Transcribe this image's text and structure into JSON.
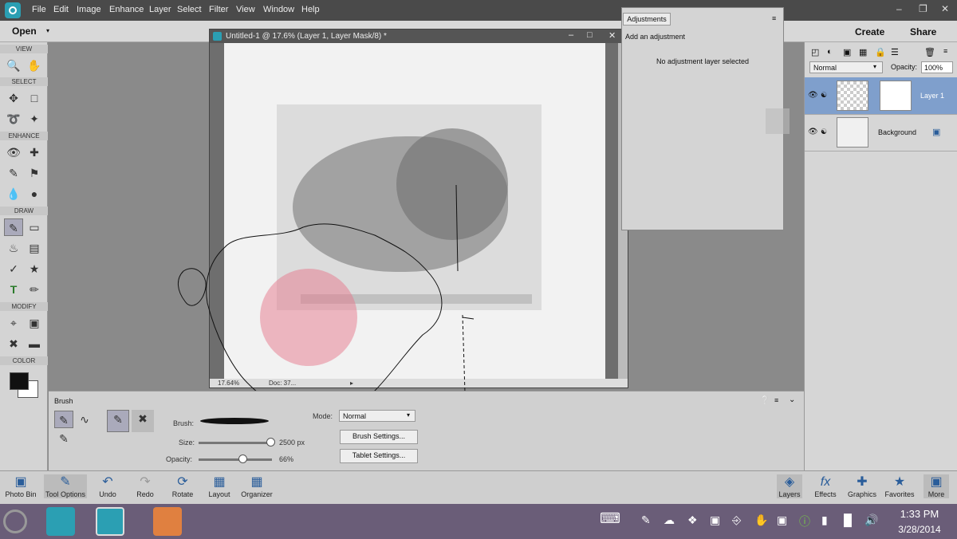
{
  "menu": [
    "File",
    "Edit",
    "Image",
    "Enhance",
    "Layer",
    "Select",
    "Filter",
    "View",
    "Window",
    "Help"
  ],
  "topbar": {
    "open": "Open",
    "create": "Create",
    "share": "Share"
  },
  "toolbox": {
    "sections": {
      "view": "VIEW",
      "select": "SELECT",
      "enhance": "ENHANCE",
      "draw": "DRAW",
      "modify": "MODIFY",
      "color": "COLOR"
    }
  },
  "document": {
    "title": "Untitled-1 @ 17.6% (Layer 1, Layer Mask/8) *",
    "zoom": "17.64%",
    "doc": "Doc: 37..."
  },
  "adjustments": {
    "tab": "Adjustments",
    "title": "Add an adjustment",
    "message": "No adjustment layer selected"
  },
  "layers": {
    "blend_mode": "Normal",
    "opacity_label": "Opacity:",
    "opacity_value": "100%",
    "items": [
      {
        "name": "Layer 1"
      },
      {
        "name": "Background"
      }
    ]
  },
  "tool_options": {
    "name": "Brush",
    "brush_label": "Brush:",
    "size_label": "Size:",
    "size_value": "2500 px",
    "opacity_label": "Opacity:",
    "opacity_value": "66%",
    "mode_label": "Mode:",
    "mode_value": "Normal",
    "brush_settings": "Brush Settings...",
    "tablet_settings": "Tablet Settings...",
    "size_fraction": 0.98,
    "opacity_fraction": 0.6
  },
  "bottom_bar": {
    "left": [
      "Photo Bin",
      "Tool Options",
      "Undo",
      "Redo",
      "Rotate",
      "Layout",
      "Organizer"
    ],
    "right": [
      "Layers",
      "Effects",
      "Graphics",
      "Favorites",
      "More"
    ]
  },
  "taskbar": {
    "time": "1:33 PM",
    "date": "3/28/2014"
  }
}
